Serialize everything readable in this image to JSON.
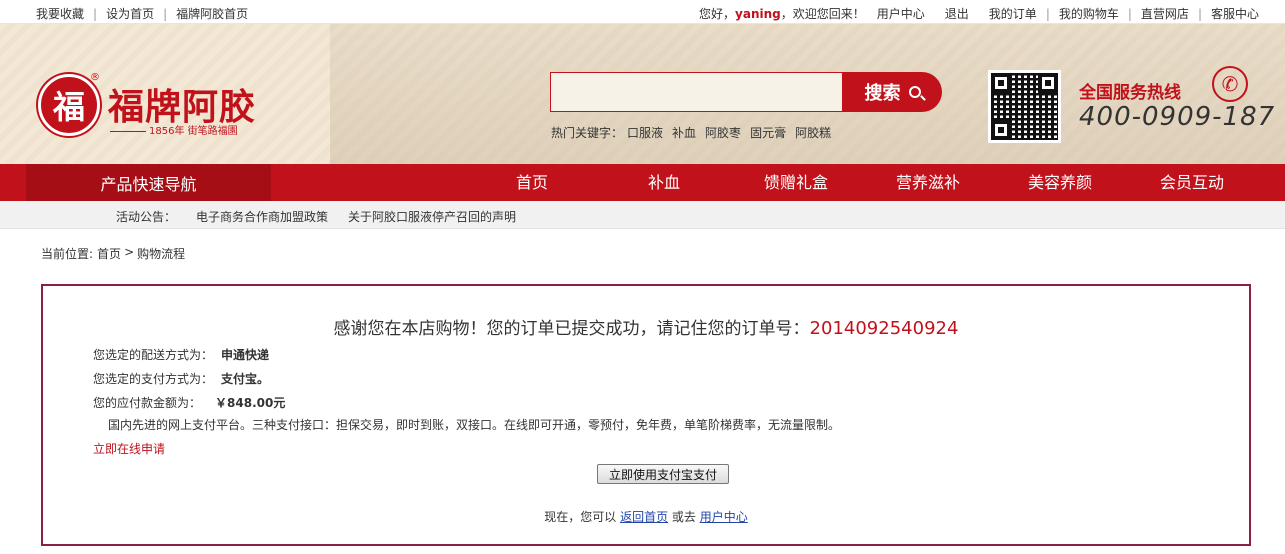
{
  "topbar": {
    "left_items": [
      "我要收藏",
      "设为首页",
      "福牌阿胶首页"
    ],
    "greeting_prefix": "您好，",
    "username": "yaning",
    "greeting_suffix": "，欢迎您回来！",
    "right_items": [
      "用户中心",
      "退出",
      "我的订单",
      "我的购物车",
      "直营网店",
      "客服中心"
    ]
  },
  "header": {
    "logo_char": "福",
    "logo_text": "福牌阿胶",
    "logo_subtitle": "1856年 街笔路福園",
    "search_placeholder": "",
    "search_button": "搜索",
    "hot_label": "热门关键字：",
    "hot_keywords": [
      "口服液",
      "补血",
      "阿胶枣",
      "固元膏",
      "阿胶糕"
    ],
    "hotline_label": "全国服务热线",
    "hotline_number": "400-0909-187"
  },
  "nav": {
    "quick": "产品快速导航",
    "links": [
      "首页",
      "补血",
      "馈赠礼盒",
      "营养滋补",
      "美容养颜",
      "会员互动"
    ]
  },
  "notice": {
    "label": "活动公告：",
    "items": [
      "电子商务合作商加盟政策",
      "关于阿胶口服液停产召回的声明"
    ]
  },
  "breadcrumb": {
    "prefix": "当前位置:",
    "home": "首页",
    "sep": ">",
    "current": "购物流程"
  },
  "order": {
    "thanks": "感谢您在本店购物！您的订单已提交成功，请记住您的订单号：",
    "order_no": "2014092540924",
    "shipping_label": "您选定的配送方式为：",
    "shipping_value": "申通快递",
    "payment_label": "您选定的支付方式为：",
    "payment_value": "支付宝。",
    "amount_label": "您的应付款金额为：",
    "amount_value": "￥848.00元",
    "payment_desc": "国内先进的网上支付平台。三种支付接口：担保交易，即时到账，双接口。在线即可开通，零预付，免年费，单笔阶梯费率，无流量限制。",
    "apply_link": "立即在线申请",
    "pay_button": "立即使用支付宝支付",
    "after_prefix": "现在，您可以",
    "back_home": "返回首页",
    "or_text": "或去",
    "user_center": "用户中心"
  }
}
